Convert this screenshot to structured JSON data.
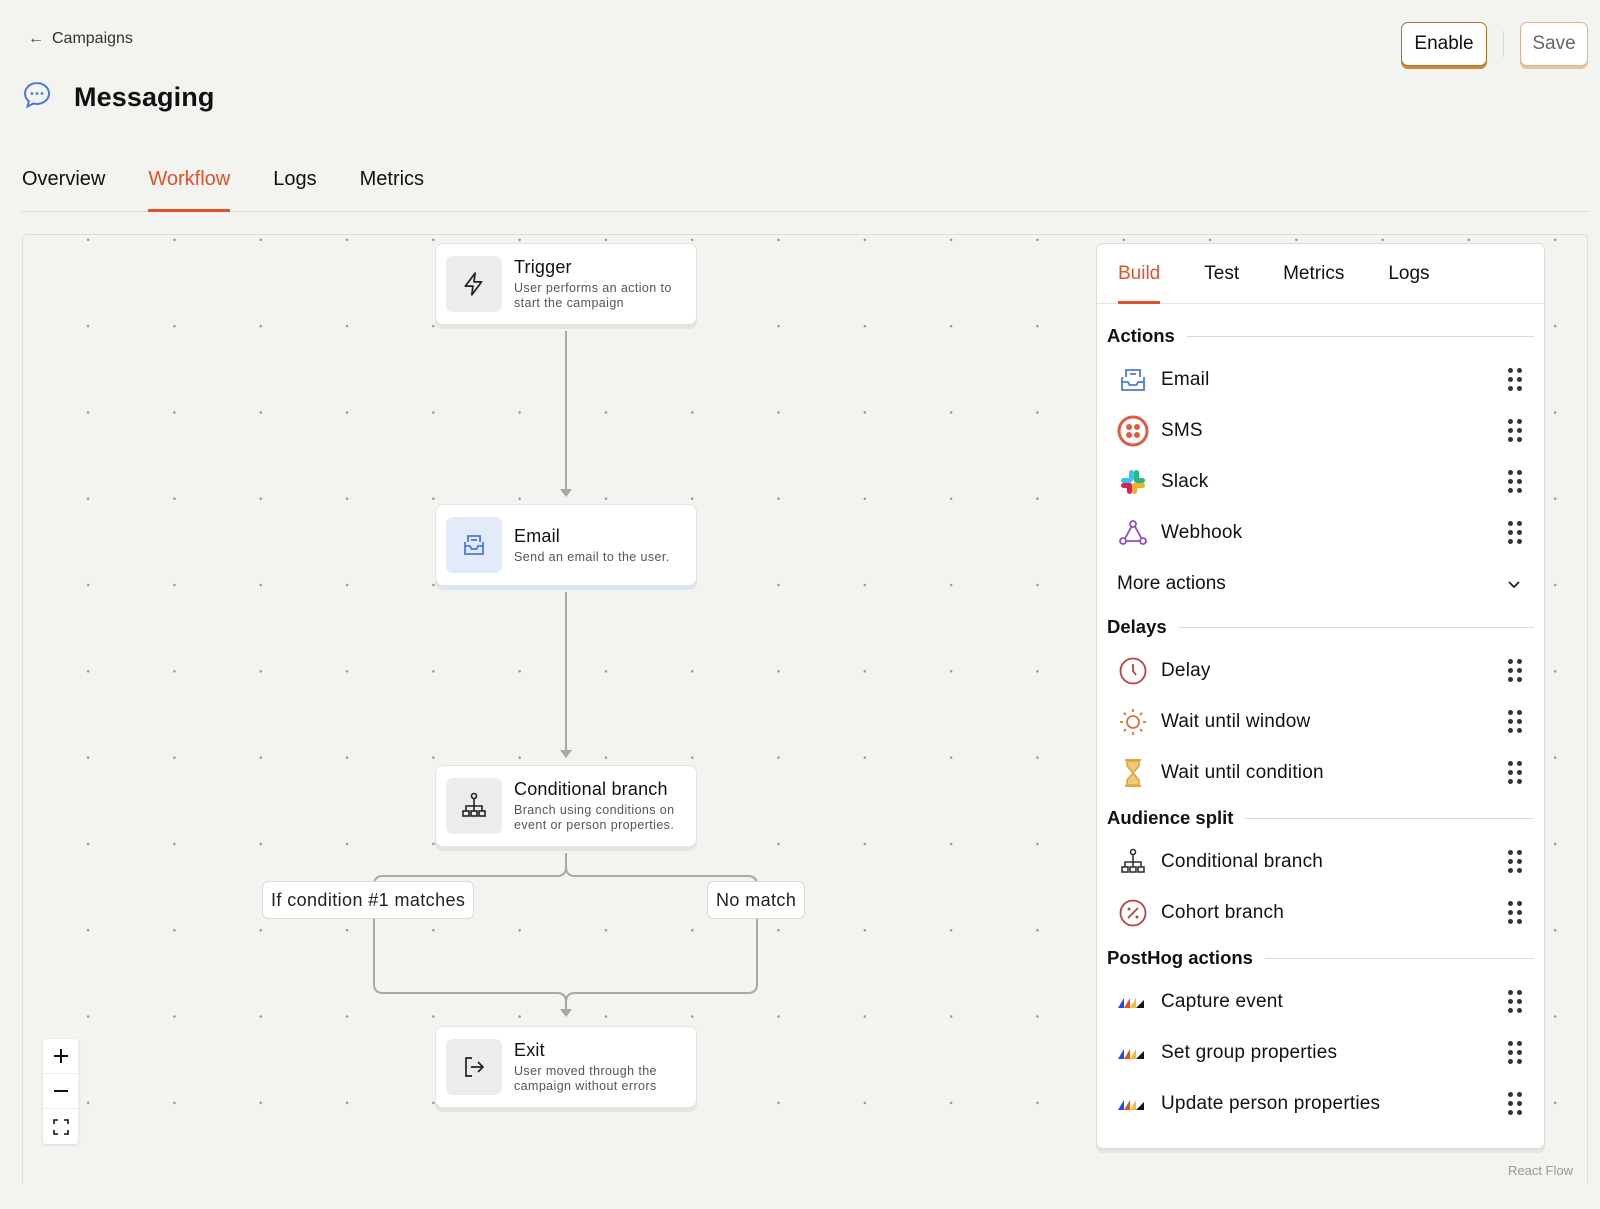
{
  "header": {
    "back_label": "Campaigns",
    "title": "Messaging",
    "enable_label": "Enable",
    "save_label": "Save"
  },
  "tabs": [
    {
      "label": "Overview",
      "active": false
    },
    {
      "label": "Workflow",
      "active": true
    },
    {
      "label": "Logs",
      "active": false
    },
    {
      "label": "Metrics",
      "active": false
    }
  ],
  "workflow": {
    "nodes": [
      {
        "title": "Trigger",
        "desc": "User performs an action to start the campaign",
        "icon": "bolt-icon"
      },
      {
        "title": "Email",
        "desc": "Send an email to the user.",
        "icon": "email-icon"
      },
      {
        "title": "Conditional branch",
        "desc": "Branch using conditions on event or person properties.",
        "icon": "branch-icon"
      },
      {
        "title": "Exit",
        "desc": "User moved through the campaign without errors",
        "icon": "exit-icon"
      }
    ],
    "edge_labels": [
      "If condition #1 matches",
      "No match"
    ]
  },
  "zoom_controls": [
    "+",
    "−",
    "fit-view"
  ],
  "attribution": "React Flow",
  "panel": {
    "tabs": [
      {
        "label": "Build",
        "active": true
      },
      {
        "label": "Test",
        "active": false
      },
      {
        "label": "Metrics",
        "active": false
      },
      {
        "label": "Logs",
        "active": false
      }
    ],
    "sections": {
      "actions": {
        "title": "Actions",
        "items": [
          "Email",
          "SMS",
          "Slack",
          "Webhook"
        ],
        "more_label": "More actions"
      },
      "delays": {
        "title": "Delays",
        "items": [
          "Delay",
          "Wait until window",
          "Wait until condition"
        ]
      },
      "audience": {
        "title": "Audience split",
        "items": [
          "Conditional branch",
          "Cohort branch"
        ]
      },
      "posthog": {
        "title": "PostHog actions",
        "items": [
          "Capture event",
          "Set group properties",
          "Update person properties"
        ]
      }
    }
  },
  "colors": {
    "accent": "#e0532a",
    "background": "#f3f3f0",
    "email_icon": "#4a78e0",
    "sms_icon": "#e05a45",
    "webhook_icon": "#8a4fd1",
    "delay_icon": "#b8433e",
    "window_icon": "#e0713a",
    "condition_icon": "#e0a540"
  }
}
